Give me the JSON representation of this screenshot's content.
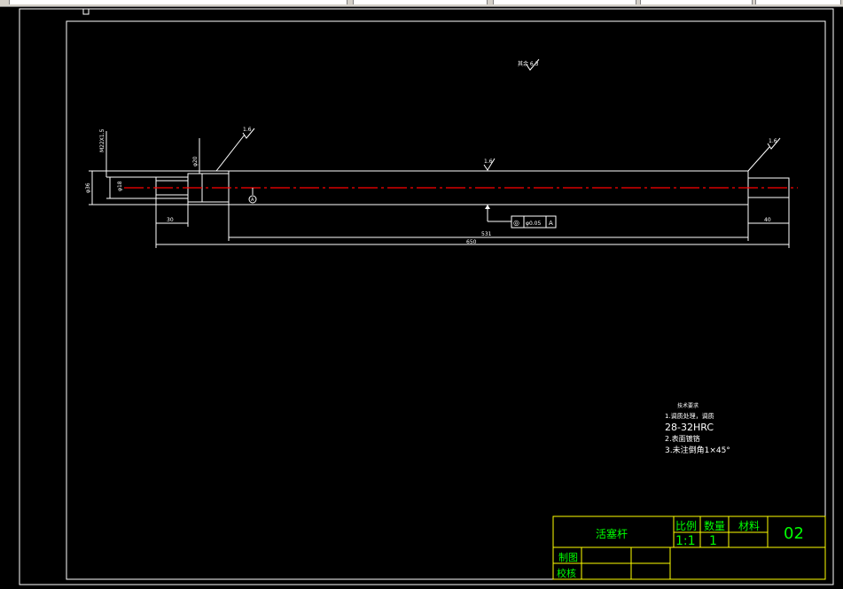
{
  "colors": {
    "background": "#000000",
    "geometry": "#ffffff",
    "centerline": "#ff0000",
    "title_block": "#ffff00",
    "title_text": "#00ff00",
    "frame_handle": "#ffffff"
  },
  "toolbar": {
    "icons": [
      "layer-icon",
      "dropdown-icon"
    ]
  },
  "dimensions": {
    "thread_label": "M22X1.5",
    "dia_shaft": "φ36",
    "dia_neck": "φ18",
    "dia_groove": "φ20",
    "len_left_end": "30",
    "len_body": "531",
    "len_total": "650",
    "len_right_end": "40"
  },
  "surface_finish": {
    "general": "其余 6.3",
    "left_shoulder": "1.6",
    "body": "1.6",
    "right_shoulder": "1.6"
  },
  "tolerance": {
    "symbol": "◎",
    "value": "φ0.05",
    "datum": "A"
  },
  "datum_marker": "A",
  "tech_requirements": {
    "title": "技术要求",
    "line1": "1.调质处理，调质",
    "line2": "28-32HRC",
    "line3": "2.表面镀铬",
    "line4": "3.未注倒角1×45°"
  },
  "title_block": {
    "part_name": "活塞杆",
    "scale_label": "比例",
    "scale_value": "1:1",
    "qty_label": "数量",
    "qty_value": "1",
    "material_label": "材料",
    "drawing_no": "02",
    "drawn_label": "制图",
    "checked_label": "校核"
  }
}
